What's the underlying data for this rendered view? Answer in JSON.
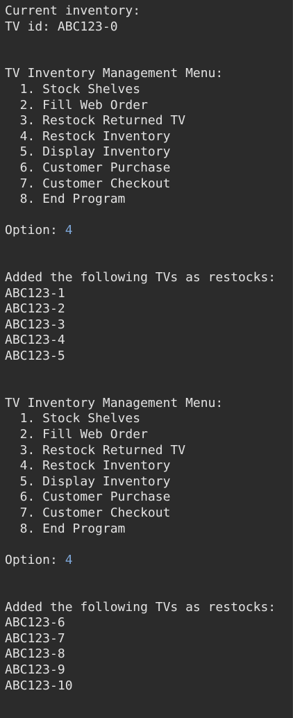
{
  "terminal": {
    "lines": [
      {
        "text": "Current inventory:"
      },
      {
        "text": "TV id: ABC123-0"
      },
      {
        "text": ""
      },
      {
        "text": ""
      },
      {
        "text": "TV Inventory Management Menu:"
      },
      {
        "text": "  1. Stock Shelves"
      },
      {
        "text": "  2. Fill Web Order"
      },
      {
        "text": "  3. Restock Returned TV"
      },
      {
        "text": "  4. Restock Inventory"
      },
      {
        "text": "  5. Display Inventory"
      },
      {
        "text": "  6. Customer Purchase"
      },
      {
        "text": "  7. Customer Checkout"
      },
      {
        "text": "  8. End Program"
      },
      {
        "text": ""
      },
      {
        "text": "Option: ",
        "input": "4"
      },
      {
        "text": ""
      },
      {
        "text": ""
      },
      {
        "text": "Added the following TVs as restocks:"
      },
      {
        "text": "ABC123-1"
      },
      {
        "text": "ABC123-2"
      },
      {
        "text": "ABC123-3"
      },
      {
        "text": "ABC123-4"
      },
      {
        "text": "ABC123-5"
      },
      {
        "text": ""
      },
      {
        "text": ""
      },
      {
        "text": "TV Inventory Management Menu:"
      },
      {
        "text": "  1. Stock Shelves"
      },
      {
        "text": "  2. Fill Web Order"
      },
      {
        "text": "  3. Restock Returned TV"
      },
      {
        "text": "  4. Restock Inventory"
      },
      {
        "text": "  5. Display Inventory"
      },
      {
        "text": "  6. Customer Purchase"
      },
      {
        "text": "  7. Customer Checkout"
      },
      {
        "text": "  8. End Program"
      },
      {
        "text": ""
      },
      {
        "text": "Option: ",
        "input": "4"
      },
      {
        "text": ""
      },
      {
        "text": ""
      },
      {
        "text": "Added the following TVs as restocks:"
      },
      {
        "text": "ABC123-6"
      },
      {
        "text": "ABC123-7"
      },
      {
        "text": "ABC123-8"
      },
      {
        "text": "ABC123-9"
      },
      {
        "text": "ABC123-10"
      }
    ]
  },
  "colors": {
    "background": "#2b2b2b",
    "text": "#e2e2e2",
    "input": "#7ea7d8"
  }
}
